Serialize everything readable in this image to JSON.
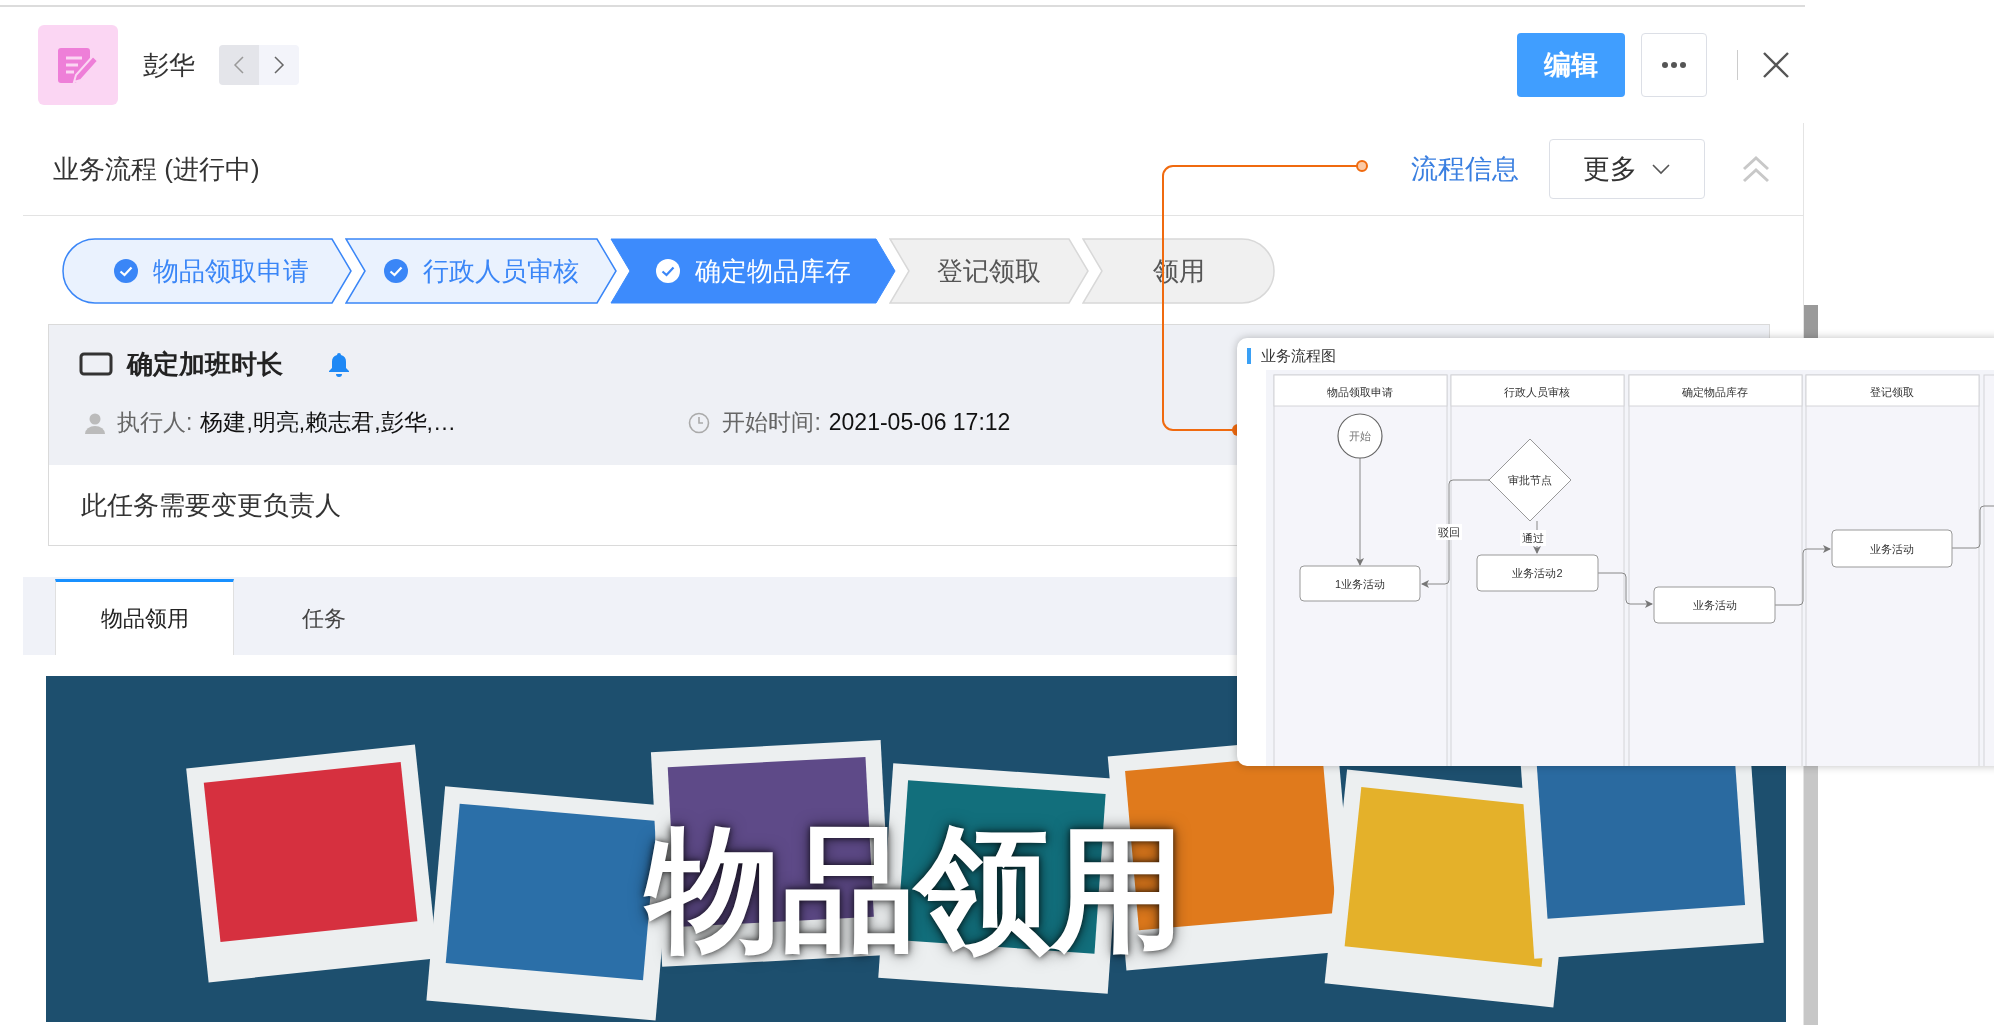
{
  "header": {
    "name": "彭华",
    "edit_button": "编辑"
  },
  "process": {
    "title": "业务流程 (进行中)",
    "info_link": "流程信息",
    "more_dropdown": "更多"
  },
  "steps": [
    {
      "label": "物品领取申请",
      "done": true,
      "selected": false
    },
    {
      "label": "行政人员审核",
      "done": true,
      "selected": false
    },
    {
      "label": "确定物品库存",
      "done": true,
      "selected": true
    },
    {
      "label": "登记领取",
      "done": false,
      "selected": false
    },
    {
      "label": "领用",
      "done": false,
      "selected": false
    }
  ],
  "task": {
    "title": "确定加班时长",
    "executors_label": "执行人:",
    "executors": "杨建,明亮,赖志君,彭华,…",
    "start_label": "开始时间:",
    "start_time": "2021-05-06 17:12",
    "note": "此任务需要变更负责人"
  },
  "tabs": [
    {
      "label": "物品领用",
      "selected": true
    },
    {
      "label": "任务",
      "selected": false
    }
  ],
  "banner": {
    "kind": "picture",
    "title": "物品领用"
  },
  "flow_popup": {
    "title": "业务流程图",
    "lanes": [
      "物品领取申请",
      "行政人员审核",
      "确定物品库存",
      "登记领取"
    ],
    "nodes": [
      {
        "kind": "start",
        "label": "开始"
      },
      {
        "kind": "decision",
        "label": "审批节点"
      },
      {
        "kind": "task",
        "label": "1业务活动"
      },
      {
        "kind": "task",
        "label": "业务活动2"
      },
      {
        "kind": "task",
        "label": "业务活动"
      },
      {
        "kind": "task",
        "label": "业务活动"
      }
    ],
    "edge_labels": [
      "驳回",
      "通过"
    ]
  }
}
